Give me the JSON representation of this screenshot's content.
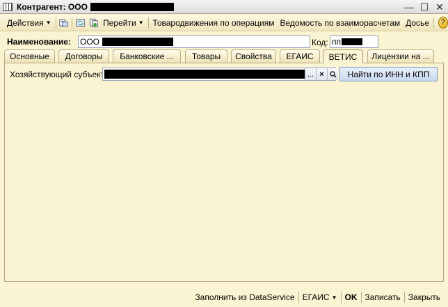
{
  "window": {
    "title": "Контрагент: ООО"
  },
  "toolbar": {
    "actions_label": "Действия",
    "goto_label": "Перейти",
    "goods_movement_label": "Товародвижения по операциям",
    "settlements_label": "Ведомость по взаиморасчетам",
    "dossier_label": "Досье",
    "icons": [
      "hierarchy-icon",
      "refresh-icon",
      "copy-icon",
      "help-icon"
    ]
  },
  "form": {
    "name_label": "Наименование:",
    "name_value": "ООО",
    "code_label": "Код:",
    "code_value": "пп"
  },
  "tabs": [
    {
      "label": "Основные",
      "active": false
    },
    {
      "label": "Договоры",
      "active": false
    },
    {
      "label": "Банковские ...",
      "active": false
    },
    {
      "label": "Товары",
      "active": false
    },
    {
      "label": "Свойства",
      "active": false
    },
    {
      "label": "ЕГАИС",
      "active": false
    },
    {
      "label": "ВЕТИС",
      "active": true
    },
    {
      "label": "Лицензии на ...",
      "active": false
    }
  ],
  "vetis": {
    "subject_label": "Хозяйствующий субъект:",
    "ellipsis": "...",
    "clear": "×",
    "find_button": "Найти по ИНН и КПП"
  },
  "footer": {
    "fill_label": "Заполнить из DataService",
    "egais_label": "ЕГАИС",
    "ok_label": "OK",
    "save_label": "Записать",
    "close_label": "Закрыть"
  }
}
